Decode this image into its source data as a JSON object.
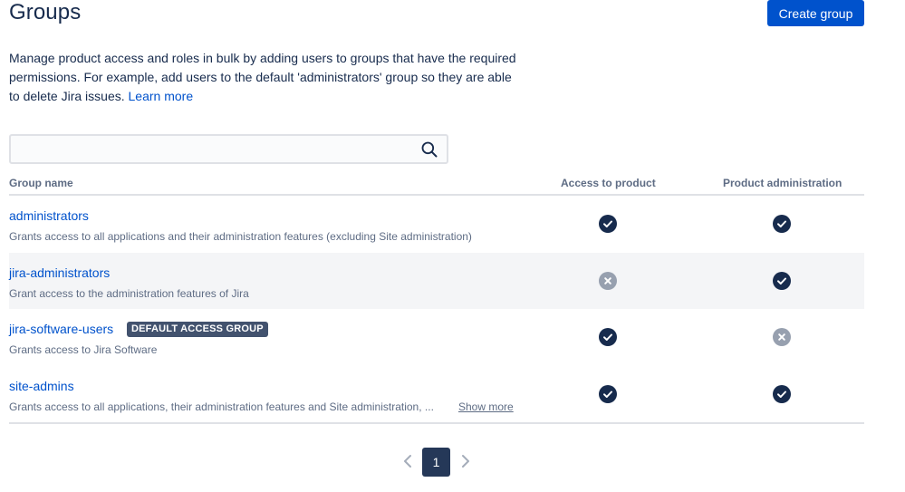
{
  "header": {
    "title": "Groups",
    "create_button": "Create group"
  },
  "intro": {
    "text": "Manage product access and roles in bulk by adding users to groups that have the required permissions. For example, add users to the default 'administrators' group so they are able to delete Jira issues. ",
    "link": "Learn more"
  },
  "search": {
    "value": "",
    "placeholder": "",
    "icon": "search-icon"
  },
  "table": {
    "columns": [
      "Group name",
      "Access to product",
      "Product administration"
    ],
    "rows": [
      {
        "name": "administrators",
        "description": "Grants access to all applications and their administration features (excluding Site administration)",
        "badge": "",
        "access": "granted",
        "admin": "granted"
      },
      {
        "name": "jira-administrators",
        "description": "Grant access to the administration features of Jira",
        "badge": "",
        "access": "denied",
        "admin": "granted"
      },
      {
        "name": "jira-software-users",
        "description": "Grants access to Jira Software",
        "badge": "DEFAULT ACCESS GROUP",
        "access": "granted",
        "admin": "denied"
      },
      {
        "name": "site-admins",
        "description": "Grants access to all applications, their administration features and Site administration, ...",
        "badge": "",
        "show_more": "Show more",
        "access": "granted",
        "admin": "granted"
      }
    ]
  },
  "pagination": {
    "current_page": "1"
  },
  "colors": {
    "primary": "#0052cc",
    "granted": "#172b4d",
    "denied": "#97a0af",
    "text_secondary": "#5e6c84"
  }
}
